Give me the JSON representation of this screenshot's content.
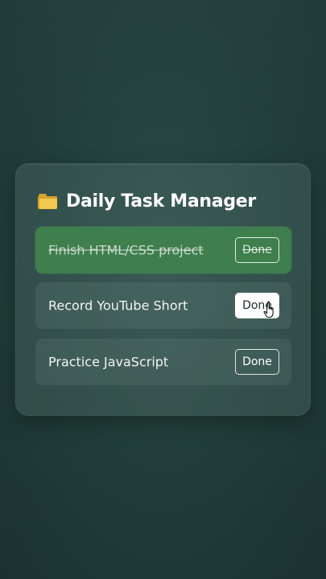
{
  "app": {
    "title": "Daily Task Manager",
    "title_icon": "folder-icon"
  },
  "tasks": [
    {
      "label": "Finish HTML/CSS project",
      "completed": true,
      "button_label": "Done"
    },
    {
      "label": "Record YouTube Short",
      "completed": false,
      "button_label": "Done",
      "hovered": true
    },
    {
      "label": "Practice JavaScript",
      "completed": false,
      "button_label": "Done"
    }
  ],
  "colors": {
    "background": "#22403c",
    "completed_task": "#3f7e4d",
    "folder": "#f3c84e"
  }
}
